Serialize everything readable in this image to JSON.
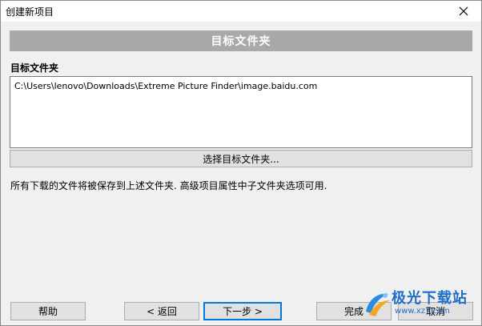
{
  "window": {
    "title": "创建新项目"
  },
  "header": {
    "title": "目标文件夹"
  },
  "target_folder": {
    "label": "目标文件夹",
    "path": "C:\\Users\\lenovo\\Downloads\\Extreme Picture Finder\\image.baidu.com",
    "choose_button": "选择目标文件夹..."
  },
  "info": {
    "text": "所有下载的文件将被保存到上述文件夹. 高级项目属性中子文件夹选项可用."
  },
  "buttons": {
    "help": "帮助",
    "back": "< 返回",
    "next": "下一步 >",
    "finish": "完成",
    "cancel": "取消"
  },
  "watermark": {
    "name": "极光下载站",
    "url": "www.xz7.com"
  },
  "colors": {
    "header_band": "#a9a9a9",
    "focus_border": "#0078d7",
    "watermark": "#1e6fc8"
  },
  "icons": {
    "close": "close-icon",
    "watermark_logo": "aurora-logo-icon"
  }
}
